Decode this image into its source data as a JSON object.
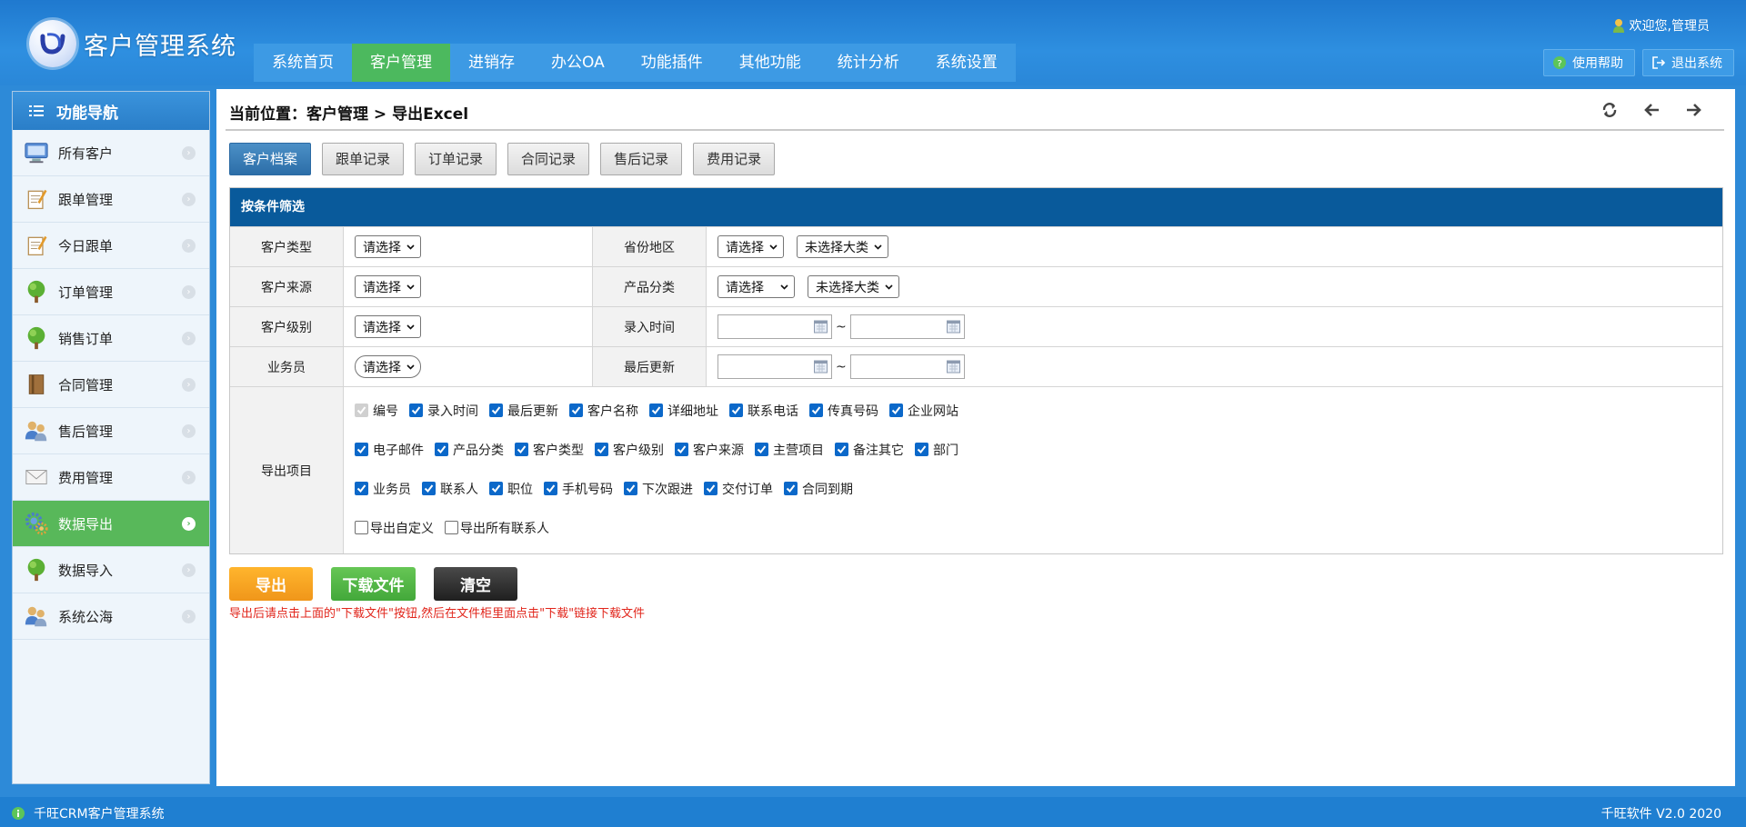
{
  "header": {
    "app_title": "客户管理系统",
    "welcome": "欢迎您,管理员",
    "help_label": "使用帮助",
    "logout_label": "退出系统"
  },
  "nav": {
    "items": [
      {
        "label": "系统首页",
        "active": false
      },
      {
        "label": "客户管理",
        "active": true
      },
      {
        "label": "进销存",
        "active": false
      },
      {
        "label": "办公OA",
        "active": false
      },
      {
        "label": "功能插件",
        "active": false
      },
      {
        "label": "其他功能",
        "active": false
      },
      {
        "label": "统计分析",
        "active": false
      },
      {
        "label": "系统设置",
        "active": false
      }
    ]
  },
  "sidebar": {
    "title": "功能导航",
    "items": [
      {
        "label": "所有客户",
        "icon": "monitor-icon"
      },
      {
        "label": "跟单管理",
        "icon": "notepad-icon"
      },
      {
        "label": "今日跟单",
        "icon": "notepad-icon"
      },
      {
        "label": "订单管理",
        "icon": "tree-icon"
      },
      {
        "label": "销售订单",
        "icon": "tree-icon"
      },
      {
        "label": "合同管理",
        "icon": "book-icon"
      },
      {
        "label": "售后管理",
        "icon": "users-icon"
      },
      {
        "label": "费用管理",
        "icon": "envelope-icon"
      },
      {
        "label": "数据导出",
        "icon": "gear-icon",
        "active": true
      },
      {
        "label": "数据导入",
        "icon": "tree-icon"
      },
      {
        "label": "系统公海",
        "icon": "users-icon"
      }
    ]
  },
  "main": {
    "breadcrumb": "当前位置：客户管理 > 导出Excel",
    "tabs": [
      {
        "label": "客户档案",
        "active": true
      },
      {
        "label": "跟单记录",
        "active": false
      },
      {
        "label": "订单记录",
        "active": false
      },
      {
        "label": "合同记录",
        "active": false
      },
      {
        "label": "售后记录",
        "active": false
      },
      {
        "label": "费用记录",
        "active": false
      }
    ],
    "filter": {
      "title": "按条件筛选",
      "rows": [
        {
          "label1": "客户类型",
          "select1": "请选择",
          "label2": "省份地区",
          "select2a": "请选择",
          "select2b": "未选择大类"
        },
        {
          "label1": "客户来源",
          "select1": "请选择",
          "label2": "产品分类",
          "select2a": "请选择",
          "select2b": "未选择大类"
        },
        {
          "label1": "客户级别",
          "select1": "请选择",
          "label2": "录入时间"
        },
        {
          "label1": "业务员",
          "select1": "请选择",
          "label2": "最后更新"
        }
      ],
      "range_sep": "~",
      "export_label": "导出项目",
      "checkbox_lines": [
        [
          "编号",
          "录入时间",
          "最后更新",
          "客户名称",
          "详细地址",
          "联系电话",
          "传真号码",
          "企业网站"
        ],
        [
          "电子邮件",
          "产品分类",
          "客户类型",
          "客户级别",
          "客户来源",
          "主营项目",
          "备注其它",
          "部门"
        ],
        [
          "业务员",
          "联系人",
          "职位",
          "手机号码",
          "下次跟进",
          "交付订单",
          "合同到期"
        ],
        [
          "导出自定义",
          "导出所有联系人"
        ]
      ]
    },
    "buttons": {
      "export": "导出",
      "download": "下载文件",
      "clear": "清空"
    },
    "note": "导出后请点击上面的\"下载文件\"按钮,然后在文件柜里面点击\"下载\"链接下载文件"
  },
  "footer": {
    "left": "千旺CRM客户管理系统",
    "right": "千旺软件 V2.0 2020"
  },
  "colors": {
    "header_blue": "#2a87d8",
    "nav_active": "#4cb95e",
    "filter_head": "#095a9b",
    "tab_active": "#2c6ea8",
    "sidebar_active": "#58b85a",
    "note_red": "#e1251b"
  }
}
